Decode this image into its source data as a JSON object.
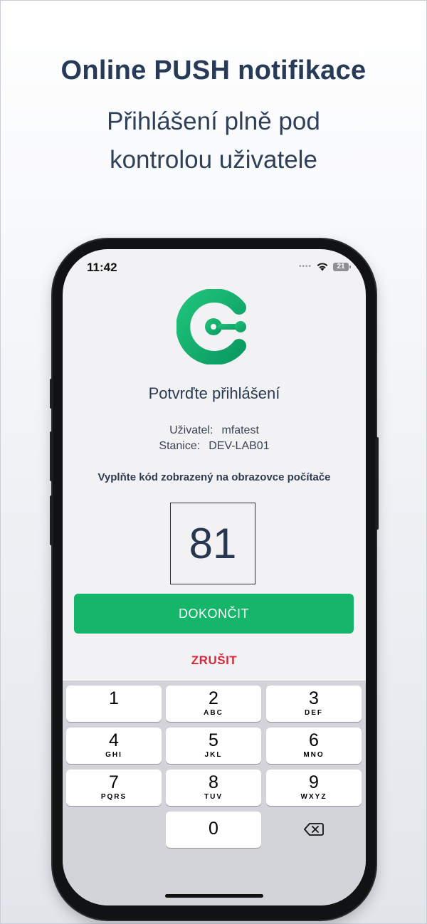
{
  "promo": {
    "headline": "Online PUSH notifikace",
    "subline_1": "Přihlášení plně pod",
    "subline_2": "kontrolou uživatele"
  },
  "status_bar": {
    "time": "11:42",
    "battery": "21",
    "icons": [
      "signal-dots-icon",
      "wifi-icon",
      "battery-icon"
    ]
  },
  "app": {
    "logo": "app-logo",
    "title": "Potvrďte přihlášení",
    "user_label": "Uživatel:",
    "user_value": "mfatest",
    "station_label": "Stanice:",
    "station_value": "DEV-LAB01",
    "instruction": "Vyplňte kód zobrazený na obrazovce počítače",
    "code": "81",
    "finish_label": "DOKONČIT",
    "cancel_label": "ZRUŠIT",
    "colors": {
      "accent": "#15b56a",
      "danger": "#d6283a",
      "text": "#27374f"
    }
  },
  "keypad": {
    "keys": [
      {
        "n": "1",
        "l": ""
      },
      {
        "n": "2",
        "l": "ABC"
      },
      {
        "n": "3",
        "l": "DEF"
      },
      {
        "n": "4",
        "l": "GHI"
      },
      {
        "n": "5",
        "l": "JKL"
      },
      {
        "n": "6",
        "l": "MNO"
      },
      {
        "n": "7",
        "l": "PQRS"
      },
      {
        "n": "8",
        "l": "TUV"
      },
      {
        "n": "9",
        "l": "WXYZ"
      },
      {
        "n": "0",
        "l": ""
      }
    ],
    "delete_icon": "backspace-icon"
  }
}
